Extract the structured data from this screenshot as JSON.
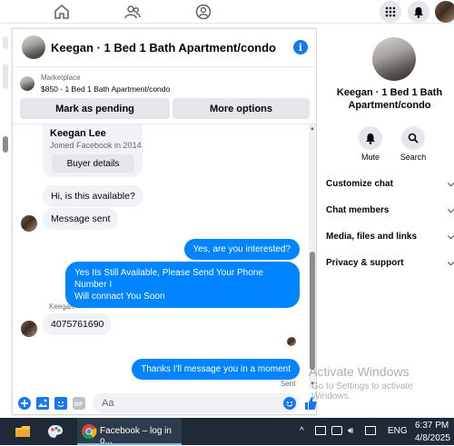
{
  "topbar": {
    "nav": [
      "home-icon",
      "groups-icon",
      "marketplace-icon"
    ],
    "right": [
      "menu-grid-icon",
      "bell-icon",
      "profile-avatar"
    ]
  },
  "chat": {
    "title": "Keegan · 1 Bed 1 Bath Apartment/condo",
    "marketplace_label": "Marketplace",
    "listing": "$850 - 1 Bed 1 Bath Apartment/condo",
    "mark_pending": "Mark as pending",
    "more_options": "More options",
    "card": {
      "name": "Keegan Lee",
      "joined": "Joined Facebook in 2014",
      "buyer_details": "Buyer details"
    },
    "messages": {
      "m1": "Hi, is this available?",
      "m2": "Message sent",
      "m3": "Yes, are you interested?",
      "m4_line1": "Yes Its Still Available, Please Send Your Phone Number I",
      "m4_line2": "Will connact You Soon",
      "sender_label": "Keegan",
      "m5": "4075761690",
      "m6": "Thanks I'll message you in a moment",
      "status": "Sent"
    },
    "composer": {
      "placeholder": "Aa"
    }
  },
  "side": {
    "title": "Keegan · 1 Bed 1 Bath Apartment/condo",
    "mute": "Mute",
    "search": "Search",
    "rows": [
      "Customize chat",
      "Chat members",
      "Media, files and links",
      "Privacy & support"
    ]
  },
  "watermark": {
    "line1": "Activate Windows",
    "line2": "Go to Settings to activate Windows."
  },
  "taskbar": {
    "app_label": "Facebook – log in o...",
    "lang": "ENG",
    "time": "6:37 PM",
    "date": "4/8/2025"
  },
  "colors": {
    "accent": "#0084ff",
    "brand": "#1877f2"
  }
}
